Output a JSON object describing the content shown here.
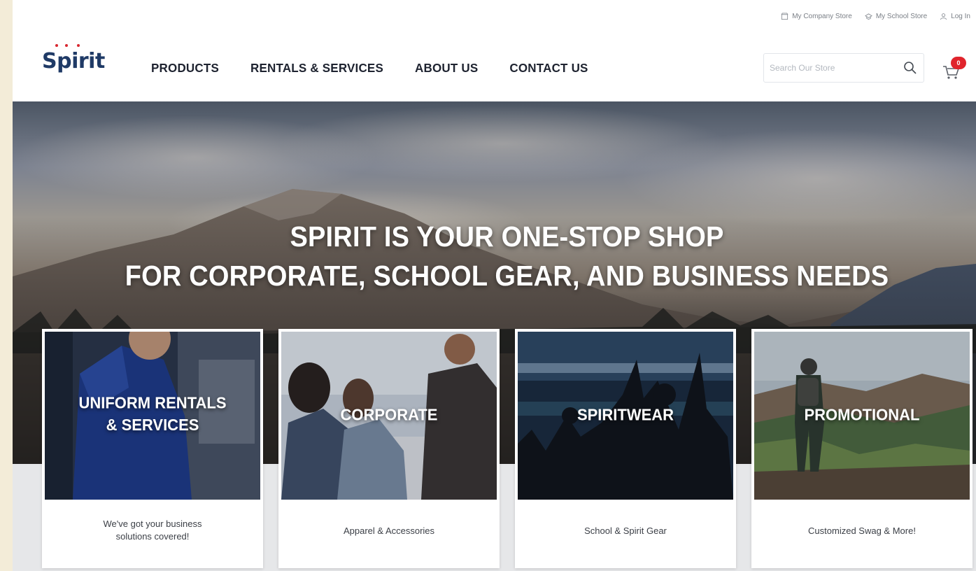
{
  "utility_links": [
    {
      "label": "My Company Store",
      "icon": "store-icon"
    },
    {
      "label": "My School Store",
      "icon": "school-icon"
    },
    {
      "label": "Log In",
      "icon": "user-icon"
    }
  ],
  "brand": {
    "logo_text": "Spirit",
    "accent": "#1f3a66",
    "dot_color": "#d8262f"
  },
  "nav": [
    {
      "label": "PRODUCTS"
    },
    {
      "label": "RENTALS & SERVICES"
    },
    {
      "label": "ABOUT US"
    },
    {
      "label": "CONTACT US"
    }
  ],
  "search": {
    "placeholder": "Search Our Store",
    "icon": "search-icon"
  },
  "cart": {
    "count": "0",
    "icon": "cart-icon",
    "badge_color": "#e0242c"
  },
  "hero": {
    "line1": "SPIRIT IS YOUR ONE-STOP SHOP",
    "line2": "FOR CORPORATE, SCHOOL GEAR, AND BUSINESS NEEDS"
  },
  "cards": [
    {
      "title": "UNIFORM RENTALS\n& SERVICES",
      "subtitle": "We've got your business\nsolutions covered!"
    },
    {
      "title": "CORPORATE",
      "subtitle": "Apparel & Accessories"
    },
    {
      "title": "SPIRITWEAR",
      "subtitle": "School & Spirit Gear"
    },
    {
      "title": "PROMOTIONAL",
      "subtitle": "Customized Swag & More!"
    }
  ]
}
